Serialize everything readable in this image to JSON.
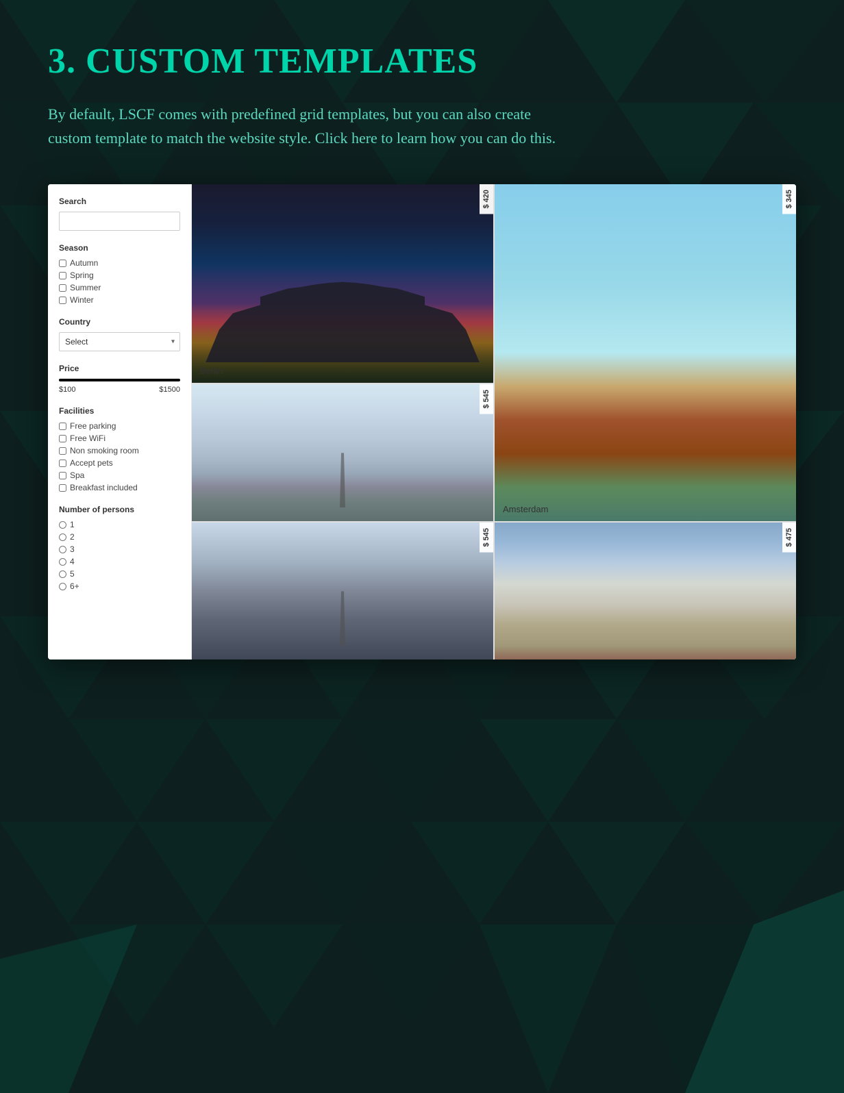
{
  "page": {
    "background_color": "#0d1f1e",
    "title": "3. Custom Templates",
    "description": "By default, LSCF comes with predefined grid templates, but you can also create custom template to match the website style. Click here to learn how you can do this.",
    "title_color": "#00d4aa",
    "description_color": "#5dd9c0"
  },
  "widget": {
    "sidebar": {
      "search_label": "Search",
      "search_placeholder": "",
      "season_label": "Season",
      "season_options": [
        "Autumn",
        "Spring",
        "Summer",
        "Winter"
      ],
      "country_label": "Country",
      "country_select_default": "Select",
      "price_label": "Price",
      "price_min": "$100",
      "price_max": "$1500",
      "facilities_label": "Facilities",
      "facilities_options": [
        "Free parking",
        "Free WiFi",
        "Non smoking room",
        "Accept pets",
        "Spa",
        "Breakfast included"
      ],
      "persons_label": "Number of persons",
      "persons_options": [
        "1",
        "2",
        "3",
        "4",
        "5",
        "6+"
      ]
    },
    "listings": [
      {
        "id": "berlin",
        "name": "Berlin",
        "price": "$ 420",
        "image_type": "berlin"
      },
      {
        "id": "amsterdam",
        "name": "Amsterdam",
        "price": "$ 345",
        "image_type": "amsterdam"
      },
      {
        "id": "paris",
        "name": "",
        "price": "$ 545",
        "image_type": "paris"
      },
      {
        "id": "boat",
        "name": "",
        "price": "$ 475",
        "image_type": "boat"
      }
    ]
  }
}
